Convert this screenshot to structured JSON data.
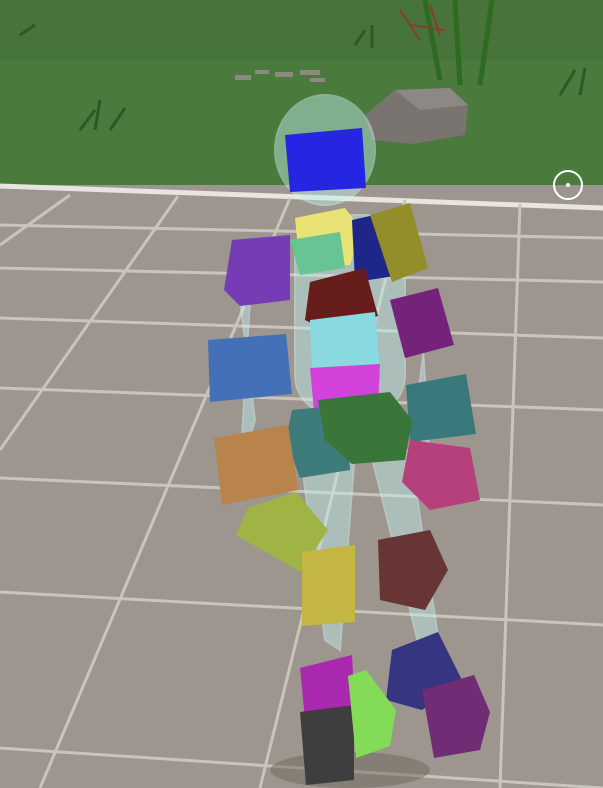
{
  "scene": {
    "grass_color": "#4a7a3c",
    "floor_color": "#9d968e",
    "tile_line_color": "#c9c4bc",
    "rock_color": "#7a7470",
    "avatar_glass_color": "#bff0ee"
  },
  "avatar": {
    "parts": [
      {
        "name": "head-cube",
        "color": "#1414e0"
      },
      {
        "name": "neck-cube",
        "color": "#e8e06a"
      },
      {
        "name": "right-clavicle-cube",
        "color": "#5cbf8a"
      },
      {
        "name": "left-clavicle-cube",
        "color": "#0c1480"
      },
      {
        "name": "left-shoulder-cube",
        "color": "#8a8418"
      },
      {
        "name": "right-shoulder-cube",
        "color": "#6a2cb0"
      },
      {
        "name": "chest-cube",
        "color": "#5c0a0a"
      },
      {
        "name": "left-upper-arm-cube",
        "color": "#6a1070"
      },
      {
        "name": "right-upper-arm-cube",
        "color": "#3464b0"
      },
      {
        "name": "spine-cube",
        "color": "#7ed6de"
      },
      {
        "name": "belly-cube",
        "color": "#d032d8"
      },
      {
        "name": "left-forearm-cube",
        "color": "#2a6e70"
      },
      {
        "name": "right-hip-cube",
        "color": "#2e7070"
      },
      {
        "name": "pelvis-cube",
        "color": "#2a6a2a"
      },
      {
        "name": "right-forearm-cube",
        "color": "#b47a3c"
      },
      {
        "name": "left-hand-cube",
        "color": "#b03070"
      },
      {
        "name": "right-hand-cube",
        "color": "#98ae36"
      },
      {
        "name": "right-thigh-cube",
        "color": "#beb032"
      },
      {
        "name": "left-thigh-cube",
        "color": "#5c2424"
      },
      {
        "name": "right-shin-cube",
        "color": "#a218a8"
      },
      {
        "name": "left-shin-cube",
        "color": "#242478"
      },
      {
        "name": "right-foot-cube",
        "color": "#2e2e2e"
      },
      {
        "name": "right-toe-cube",
        "color": "#7ad84a"
      },
      {
        "name": "left-foot-cube",
        "color": "#641c6a"
      }
    ]
  }
}
